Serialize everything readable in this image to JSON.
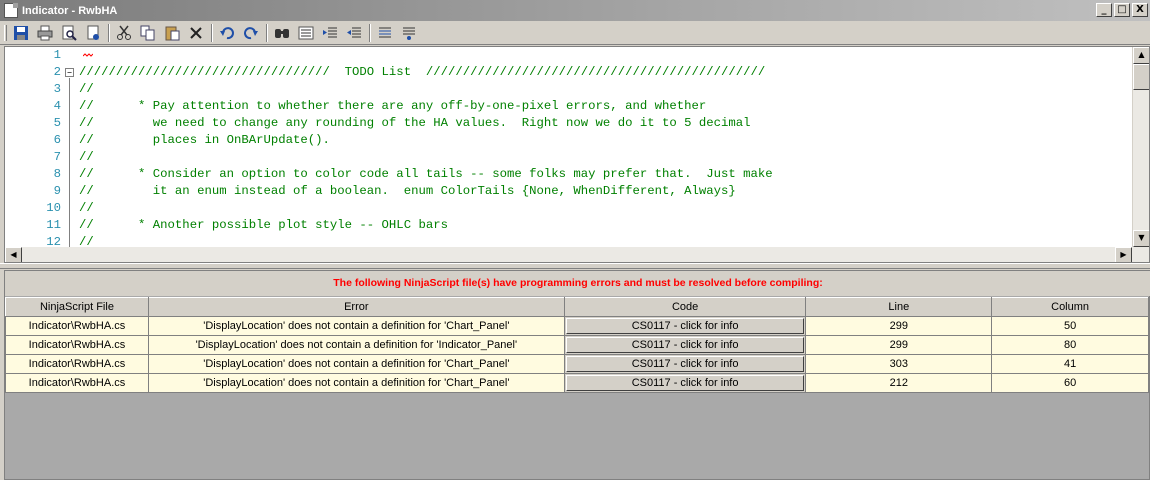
{
  "window": {
    "title": "Indicator - RwbHA"
  },
  "window_buttons": [
    "_",
    "□",
    "X"
  ],
  "toolbar": {
    "icons": [
      "save-icon",
      "print-icon",
      "print-preview-icon",
      "page-setup-icon",
      "cut-icon",
      "copy-icon",
      "paste-icon",
      "delete-icon",
      "undo-icon",
      "redo-icon",
      "find-icon",
      "replace-icon",
      "indent-icon",
      "outdent-icon",
      "comment-icon",
      "uncomment-icon"
    ]
  },
  "editor": {
    "lines": [
      {
        "num": "1",
        "text": ""
      },
      {
        "num": "2",
        "text": "//////////////////////////////////  TODO List  //////////////////////////////////////////////"
      },
      {
        "num": "3",
        "text": "//"
      },
      {
        "num": "4",
        "text": "//      * Pay attention to whether there are any off-by-one-pixel errors, and whether"
      },
      {
        "num": "5",
        "text": "//        we need to change any rounding of the HA values.  Right now we do it to 5 decimal"
      },
      {
        "num": "6",
        "text": "//        places in OnBArUpdate()."
      },
      {
        "num": "7",
        "text": "//"
      },
      {
        "num": "8",
        "text": "//      * Consider an option to color code all tails -- some folks may prefer that.  Just make"
      },
      {
        "num": "9",
        "text": "//        it an enum instead of a boolean.  enum ColorTails {None, WhenDifferent, Always}"
      },
      {
        "num": "10",
        "text": "//"
      },
      {
        "num": "11",
        "text": "//      * Another possible plot style -- OHLC bars"
      },
      {
        "num": "12",
        "text": "//"
      }
    ]
  },
  "errors": {
    "message": "The following NinjaScript file(s) have programming errors and must be resolved before compiling:",
    "columns": [
      "NinjaScript File",
      "Error",
      "Code",
      "Line",
      "Column"
    ],
    "rows": [
      {
        "file": "Indicator\\RwbHA.cs",
        "error": "'DisplayLocation' does not contain a definition for 'Chart_Panel'",
        "code": "CS0117 - click for info",
        "line": "299",
        "column": "50"
      },
      {
        "file": "Indicator\\RwbHA.cs",
        "error": "'DisplayLocation' does not contain a definition for 'Indicator_Panel'",
        "code": "CS0117 - click for info",
        "line": "299",
        "column": "80"
      },
      {
        "file": "Indicator\\RwbHA.cs",
        "error": "'DisplayLocation' does not contain a definition for 'Chart_Panel'",
        "code": "CS0117 - click for info",
        "line": "303",
        "column": "41"
      },
      {
        "file": "Indicator\\RwbHA.cs",
        "error": "'DisplayLocation' does not contain a definition for 'Chart_Panel'",
        "code": "CS0117 - click for info",
        "line": "212",
        "column": "60"
      }
    ]
  },
  "colors": {
    "comment": "#008000",
    "line_number": "#2b91af",
    "error_text": "#ff0000",
    "row_bg": "#fffbe0"
  }
}
